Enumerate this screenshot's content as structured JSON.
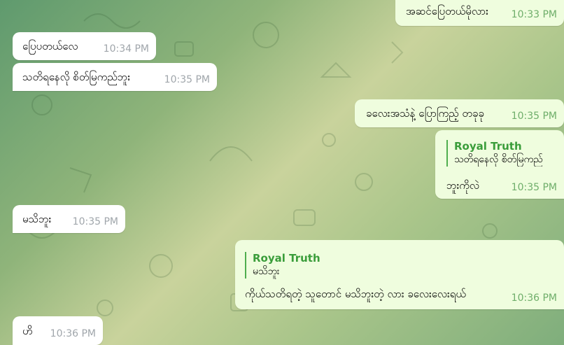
{
  "messages": [
    {
      "id": "m1",
      "side": "out",
      "text": "အဆင်ပြေတယ်မိုလား",
      "time": "10:33 PM"
    },
    {
      "id": "m2",
      "side": "in",
      "text": "ပြေပတယ်လေ",
      "time": "10:34 PM"
    },
    {
      "id": "m3",
      "side": "in",
      "text": "သတိရနေလို စိတ်မြကည်ဘူး",
      "time": "10:35 PM"
    },
    {
      "id": "m4",
      "side": "out",
      "text": "ခလေးအသံနဲ့ ပြောကြည့် တခုခု",
      "time": "10:35 PM"
    },
    {
      "id": "m5",
      "side": "out",
      "reply_name": "Royal Truth",
      "reply_text": "သတိရနေလို စိတ်မြကည်",
      "text": "ဘူးကိုလဲ",
      "time": "10:35 PM"
    },
    {
      "id": "m6",
      "side": "in",
      "text": "မသိဘူး",
      "time": "10:35 PM"
    },
    {
      "id": "m7",
      "side": "out",
      "reply_name": "Royal Truth",
      "reply_text": "မသိဘူး",
      "text": "ကိုယ်သတိရတဲ့ သူတောင် မသိဘူးတဲ့ လား ခလေးလေးရယ်",
      "time": "10:36 PM"
    },
    {
      "id": "m8",
      "side": "in",
      "text": "ဟိ",
      "time": "10:36 PM"
    }
  ],
  "colors": {
    "incoming_bubble": "#ffffff",
    "outgoing_bubble": "#effdde",
    "reply_accent": "#3a9d3a",
    "time_in": "#a0a6ab",
    "time_out": "#6fae6a"
  }
}
